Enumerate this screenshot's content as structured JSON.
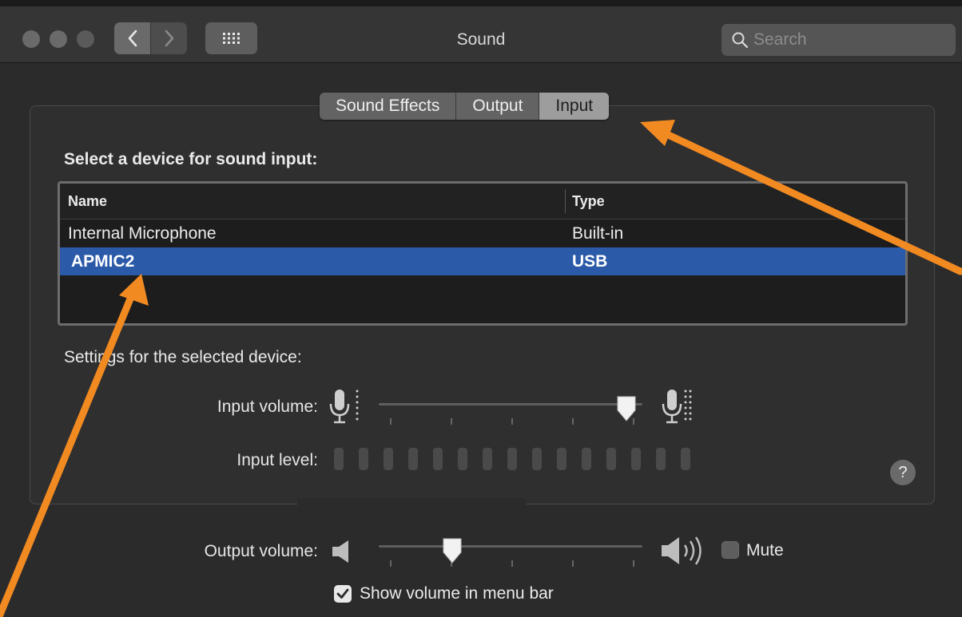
{
  "window": {
    "title": "Sound"
  },
  "search": {
    "placeholder": "Search"
  },
  "tabs": [
    {
      "label": "Sound Effects",
      "active": false
    },
    {
      "label": "Output",
      "active": false
    },
    {
      "label": "Input",
      "active": true
    }
  ],
  "input_panel": {
    "device_heading": "Select a device for sound input:",
    "columns": [
      "Name",
      "Type"
    ],
    "devices": [
      {
        "name": "Internal Microphone",
        "type": "Built-in",
        "selected": false
      },
      {
        "name": "APMIC2",
        "type": "USB",
        "selected": true
      }
    ],
    "settings_heading": "Settings for the selected device:",
    "input_volume_label": "Input volume:",
    "input_volume": 0.94,
    "input_level_label": "Input level:",
    "input_level_segments": 15,
    "input_level_active": 0
  },
  "output": {
    "volume_label": "Output volume:",
    "volume": 0.28,
    "mute_label": "Mute",
    "mute_checked": false,
    "show_in_menu_bar_label": "Show volume in menu bar",
    "show_in_menu_bar_checked": true
  },
  "colors": {
    "selection": "#2b5aa8",
    "annotation_arrow": "#f28a22",
    "window_bg": "#2b2b2b"
  }
}
